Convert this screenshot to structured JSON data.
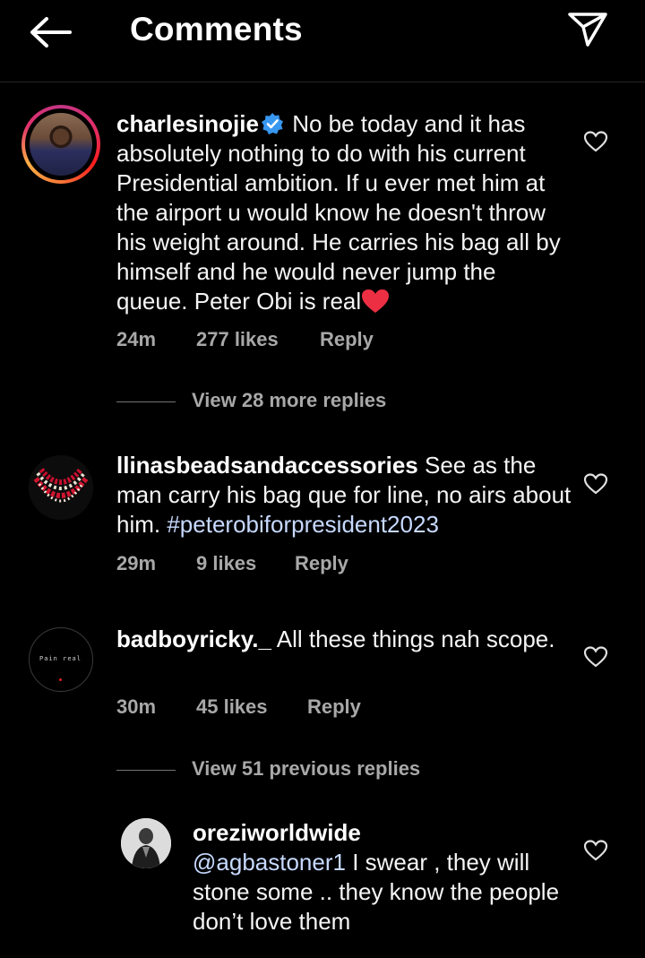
{
  "header": {
    "title": "Comments",
    "back_icon": "back-arrow-icon",
    "send_icon": "send-icon"
  },
  "comments": [
    {
      "username": "charlesinojie",
      "verified": true,
      "text": " No be today and it has absolutely nothing to do with his current Presidential ambition. If u ever met him at the airport u would know he doesn't throw his weight around. He carries his bag all by himself and he would never jump the queue. Peter Obi is real",
      "time": "24m",
      "likes": "277 likes",
      "reply_label": "Reply",
      "view_replies": "View 28 more replies"
    },
    {
      "username": "llinasbeadsandaccessories",
      "text": " See as the man carry his bag que for line, no airs about him. ",
      "hashtag": "#peterobiforpresident2023",
      "time": "29m",
      "likes": "9 likes",
      "reply_label": "Reply"
    },
    {
      "username": "badboyricky._",
      "avatar_text": "Pain real",
      "text": " All these things nah scope.",
      "time": "30m",
      "likes": "45 likes",
      "reply_label": "Reply",
      "view_replies": "View 51 previous replies"
    },
    {
      "username": "oreziworldwide",
      "mention": "@agbastoner1",
      "text": " I swear , they will stone some .. they know the people don’t love them"
    }
  ],
  "colors": {
    "background": "#000000",
    "text": "#f5f5f5",
    "secondary": "#a8a8a8",
    "verified": "#3897f0",
    "heart": "#ed4956",
    "hashtag": "#c7d9ff"
  }
}
